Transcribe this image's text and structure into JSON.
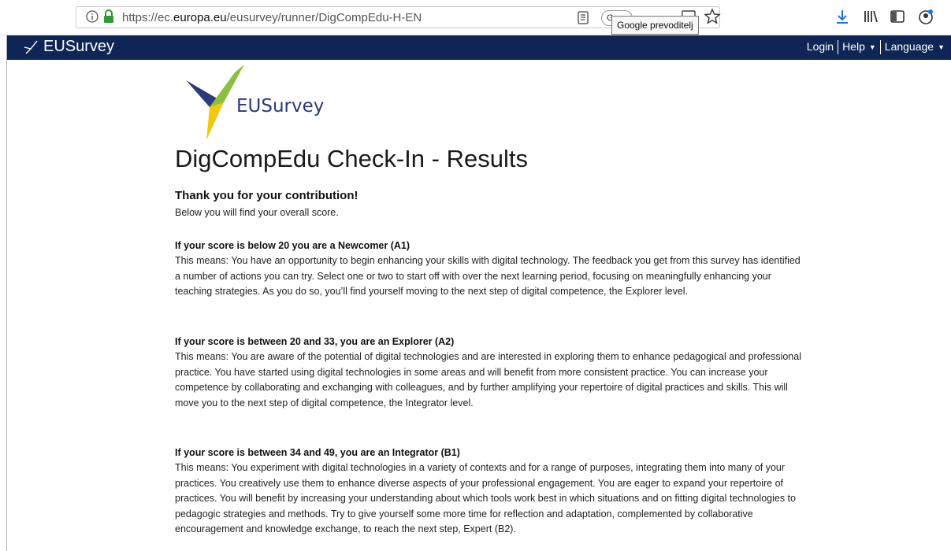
{
  "browser": {
    "url_prefix": "https://ec.",
    "url_domain": "europa.eu",
    "url_path": "/eusurvey/runner/DigCompEdu-H-EN",
    "translate_pill": "G",
    "tooltip": "Google prevoditelj"
  },
  "header": {
    "logo": "EUSurvey",
    "nav": {
      "login": "Login",
      "help": "Help",
      "language": "Language"
    }
  },
  "content": {
    "logo_text": "EUSurvey",
    "title": "DigCompEdu Check-In - Results",
    "thanks": "Thank you for your contribution!",
    "intro": "Below you will find your overall score.",
    "levels": [
      {
        "heading": "If your score is below 20 you are a Newcomer (A1)",
        "body": "This means: You have an opportunity to begin enhancing your skills with digital technology. The feedback you get from this survey has identified a number of actions you can try. Select one or two to start off with over the next learning period, focusing on meaningfully enhancing your teaching strategies. As you do so, you’ll find yourself moving to the next step of digital competence, the Explorer level."
      },
      {
        "heading": "If your score is between 20 and 33, you are an Explorer (A2)",
        "body": "This means: You are aware of the potential of digital technologies and are interested in exploring them to enhance pedagogical and professional practice. You have started using digital technologies in some areas and will benefit from more consistent practice. You can increase your competence by collaborating and exchanging with colleagues, and by further amplifying your repertoire of digital practices and skills. This will move you to the next step of digital competence, the Integrator level."
      },
      {
        "heading": "If your score is between 34 and 49, you are an Integrator (B1)",
        "body": "This means: You experiment with digital technologies in a variety of contexts and for a range of purposes, integrating them into many of your practices. You creatively use them to enhance diverse aspects of your professional engagement. You are eager to expand your repertoire of practices. You will benefit by increasing your understanding about which tools work best in which situations and on fitting digital technologies to pedagogic strategies and methods. Try to give yourself some more time for reflection and adaptation, complemented by collaborative encouragement and knowledge exchange, to reach the next step, Expert (B2)."
      }
    ]
  },
  "colors": {
    "header_bg": "#0f2555",
    "lock_green": "#2e9b34",
    "download_blue": "#1a73e8"
  }
}
